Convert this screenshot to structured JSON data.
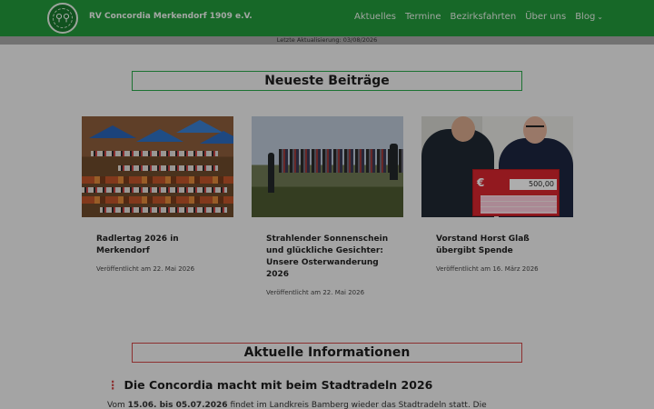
{
  "header": {
    "site_title": "RV Concordia Merkendorf 1909 e.V.",
    "nav": [
      {
        "label": "Aktuelles"
      },
      {
        "label": "Termine"
      },
      {
        "label": "Bezirksfahrten"
      },
      {
        "label": "Über uns"
      },
      {
        "label": "Blog"
      }
    ]
  },
  "update_bar": "Letzte Aktualisierung: 03/08/2026",
  "posts_section": {
    "title": "Neueste Beiträge",
    "cards": [
      {
        "title": "Radlertag 2026 in Merkendorf",
        "date": "Veröffentlicht am 22. Mai 2026"
      },
      {
        "title": "Strahlender Sonnenschein und glückliche Gesichter: Unsere Osterwanderung 2026",
        "date": "Veröffentlicht am 22. Mai 2026"
      },
      {
        "title": "Vorstand Horst Glaß übergibt Spende",
        "date": "Veröffentlicht am 16. März 2026"
      }
    ],
    "cheque_amount": "500,00"
  },
  "info_section": {
    "title": "Aktuelle Informationen",
    "article_title": "Die Concordia macht mit beim Stadtradeln 2026",
    "text_prefix": "Vom ",
    "text_bold": "15.06. bis 05.07.2026",
    "text_rest": " findet im Landkreis Bamberg wieder das Stadtradeln statt. Die"
  },
  "colors": {
    "header": "#239a3b",
    "accent_green": "#2aa84a",
    "accent_red": "#d04848"
  }
}
